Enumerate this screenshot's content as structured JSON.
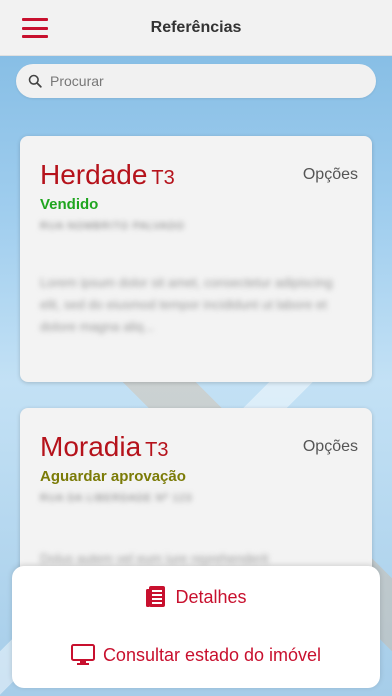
{
  "header": {
    "title": "Referências",
    "menu_icon": "hamburger-menu-icon"
  },
  "search": {
    "placeholder": "Procurar",
    "icon": "search-icon"
  },
  "properties": [
    {
      "name": "Herdade",
      "type": "T3",
      "status": "Vendido",
      "status_color": "#1fa51f",
      "options_label": "Opções",
      "address": "RUA NOMBRITO PALVADO",
      "description": "Lorem ipsum dolor sit amet, consectetur adipiscing elit, sed do eiusmod tempor incididunt ut labore et dolore magna aliq..."
    },
    {
      "name": "Moradia",
      "type": "T3",
      "status": "Aguardar aprovação",
      "status_color": "#7b7b07",
      "options_label": "Opções",
      "address": "RUA DA LIBERDADE Nº 123",
      "description": "Dolus autem vel eum iure reprehenderit"
    }
  ],
  "action_sheet": {
    "details_label": "Detalhes",
    "details_icon": "document-list-icon",
    "status_label": "Consultar estado do imóvel",
    "status_icon": "monitor-icon"
  },
  "colors": {
    "accent": "#c8102e",
    "name": "#b5121b"
  }
}
